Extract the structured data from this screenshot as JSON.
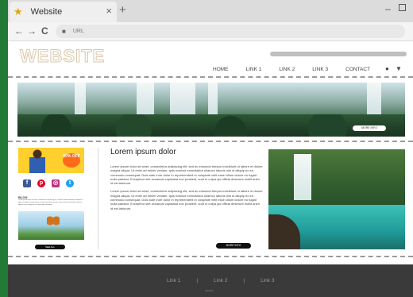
{
  "browser": {
    "tab_title": "Website",
    "tab_close_glyph": "×",
    "new_tab_glyph": "+",
    "window_min_glyph": "–",
    "back_glyph": "←",
    "forward_glyph": "→",
    "reload_glyph": "C",
    "home_glyph": "⌂",
    "lock_glyph": "🔒",
    "url_text": "URL"
  },
  "site": {
    "logo": "WEBSITE",
    "menu": [
      "HOME",
      "LINK 1",
      "LINK 2",
      "LINK 3",
      "CONTACT"
    ],
    "user_glyph": "👤",
    "cart_glyph": "🛒"
  },
  "hero": {
    "button_label": "MORE INFO"
  },
  "sidebar": {
    "ad_badge": "50% OFF",
    "socials": [
      {
        "name": "facebook",
        "glyph": "f",
        "color": "#3b5998"
      },
      {
        "name": "pinterest",
        "glyph": "p",
        "color": "#e60023"
      },
      {
        "name": "instagram",
        "glyph": "◎",
        "color": "#c13584"
      },
      {
        "name": "twitter",
        "glyph": "t",
        "color": "#1da1f2"
      }
    ],
    "blog_title": "BLOG",
    "blog_text": "Lorem ipsum dolor sit amet, consectetur adipiscing elit, sed do eiusmod tempor incididunt ut labore et dolore magna aliqua. Ut enim ad minim veniam, quis nostrud exercitation ullamco laboris nisi ut aliquip ex ea commodo consequat.",
    "button_label": "SEE ALL"
  },
  "article": {
    "title": "Lorem ipsum dolor",
    "paragraphs": [
      "Lorem ipsum dolor sit amet, consectetur adipiscing elit, sed do eiusmod tempor incididunt ut labore et dolore magna aliqua. Ut enim ad minim veniam, quis nostrud exercitation ullamco laboris nisi ut aliquip ex ea commodo consequat. Duis aute irure dolor in reprehenderit in voluptate velit esse cillum dolore eu fugiat nulla pariatur. Excepteur sint occaecat cupidatat non proident, sunt in culpa qui officia deserunt mollit anim id est laborum.",
      "Lorem ipsum dolor sit amet, consectetur adipiscing elit, sed do eiusmod tempor incididunt ut labore et dolore magna aliqua. Ut enim ad minim veniam, quis nostrud exercitation ullamco laboris nisi ut aliquip ex ea commodo consequat. Duis aute irure dolor in reprehenderit in voluptate velit esse cillum dolore eu fugiat nulla pariatur. Excepteur sint occaecat cupidatat non proident, sunt in culpa qui officia deserunt mollit anim id est laborum."
    ],
    "button_label": "MORE INFO"
  },
  "footer": {
    "links": [
      "Link 1",
      "Link 2",
      "Link 3"
    ],
    "separator": "|",
    "copyright": "Website"
  },
  "colors": {
    "background_stripe": "#1d6a2f",
    "footer": "#3a3a3a",
    "ad_yellow": "#ffcf2e"
  }
}
